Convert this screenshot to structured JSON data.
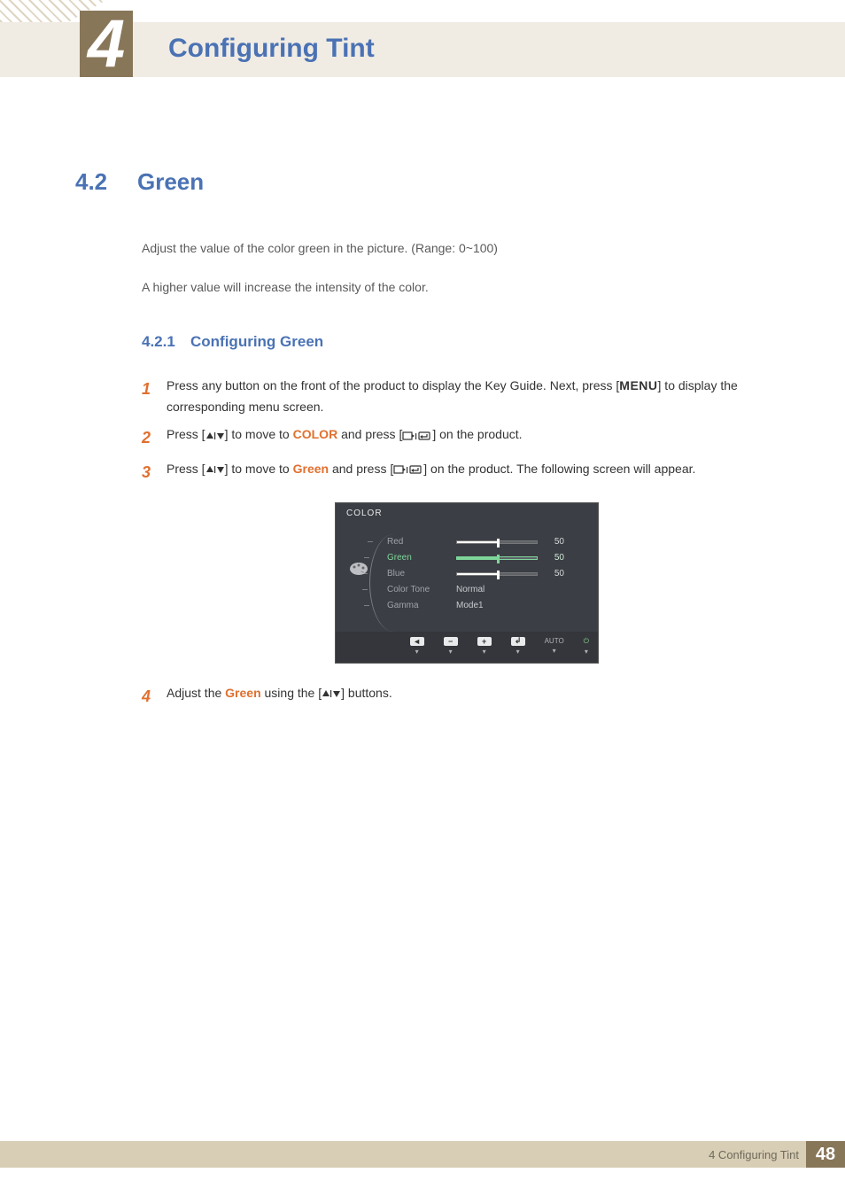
{
  "header": {
    "chapter_number": "4",
    "chapter_title": "Configuring Tint"
  },
  "section": {
    "number": "4.2",
    "title": "Green",
    "intro_p1": "Adjust the value of the color green in the picture. (Range: 0~100)",
    "intro_p2": "A higher value will increase the intensity of the color."
  },
  "subsection": {
    "number": "4.2.1",
    "title": "Configuring Green"
  },
  "steps": {
    "s1_num": "1",
    "s1_a": "Press any button on the front of the product to display the Key Guide. Next, press [",
    "s1_menu": "MENU",
    "s1_b": "] to display the corresponding menu screen.",
    "s2_num": "2",
    "s2_a": "Press [",
    "s2_b": "] to move to ",
    "s2_color": "COLOR",
    "s2_c": " and press [",
    "s2_d": "] on the product.",
    "s3_num": "3",
    "s3_a": "Press [",
    "s3_b": "] to move to ",
    "s3_green": "Green",
    "s3_c": " and press [",
    "s3_d": "] on the product. The following screen will appear.",
    "s4_num": "4",
    "s4_a": "Adjust the ",
    "s4_green": "Green",
    "s4_b": " using the [",
    "s4_c": "] buttons."
  },
  "osd": {
    "title": "COLOR",
    "rows": [
      {
        "label": "Red",
        "value": "50",
        "progress": 50
      },
      {
        "label": "Green",
        "value": "50",
        "progress": 50,
        "selected": true
      },
      {
        "label": "Blue",
        "value": "50",
        "progress": 50
      }
    ],
    "options": [
      {
        "label": "Color Tone",
        "value": "Normal"
      },
      {
        "label": "Gamma",
        "value": "Mode1"
      }
    ],
    "footer_auto": "AUTO"
  },
  "footer": {
    "text": "4 Configuring Tint",
    "page": "48"
  },
  "chart_data": {
    "type": "table",
    "title": "COLOR OSD values",
    "rows": [
      {
        "item": "Red",
        "value": 50
      },
      {
        "item": "Green",
        "value": 50
      },
      {
        "item": "Blue",
        "value": 50
      },
      {
        "item": "Color Tone",
        "value": "Normal"
      },
      {
        "item": "Gamma",
        "value": "Mode1"
      }
    ]
  }
}
